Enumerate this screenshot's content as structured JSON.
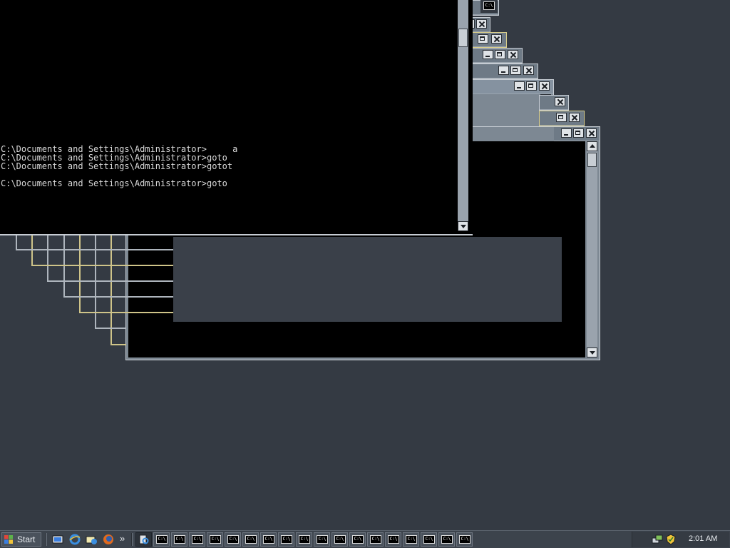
{
  "console": {
    "lines": [
      "C:\\Documents and Settings\\Administrator>     a",
      "C:\\Documents and Settings\\Administrator>goto",
      "C:\\Documents and Settings\\Administrator>gotot",
      "",
      "C:\\Documents and Settings\\Administrator>goto"
    ]
  },
  "windows": {
    "small_icon_label": "C:\\"
  },
  "taskbar": {
    "start_label": "Start",
    "overflow_label": "»",
    "task_icon_label": "C:\\",
    "task_count": 19,
    "quick_launch": [
      "show-desktop-icon",
      "internet-explorer-icon",
      "outlook-express-icon",
      "firefox-icon"
    ],
    "clock": "2:01 AM"
  },
  "colors": {
    "desktop": "#343a43",
    "console_background": "#000000",
    "console_text": "#d9d9d9",
    "window_frame": "#c6ccd3",
    "window_frame_gold": "#d8cd8a"
  }
}
